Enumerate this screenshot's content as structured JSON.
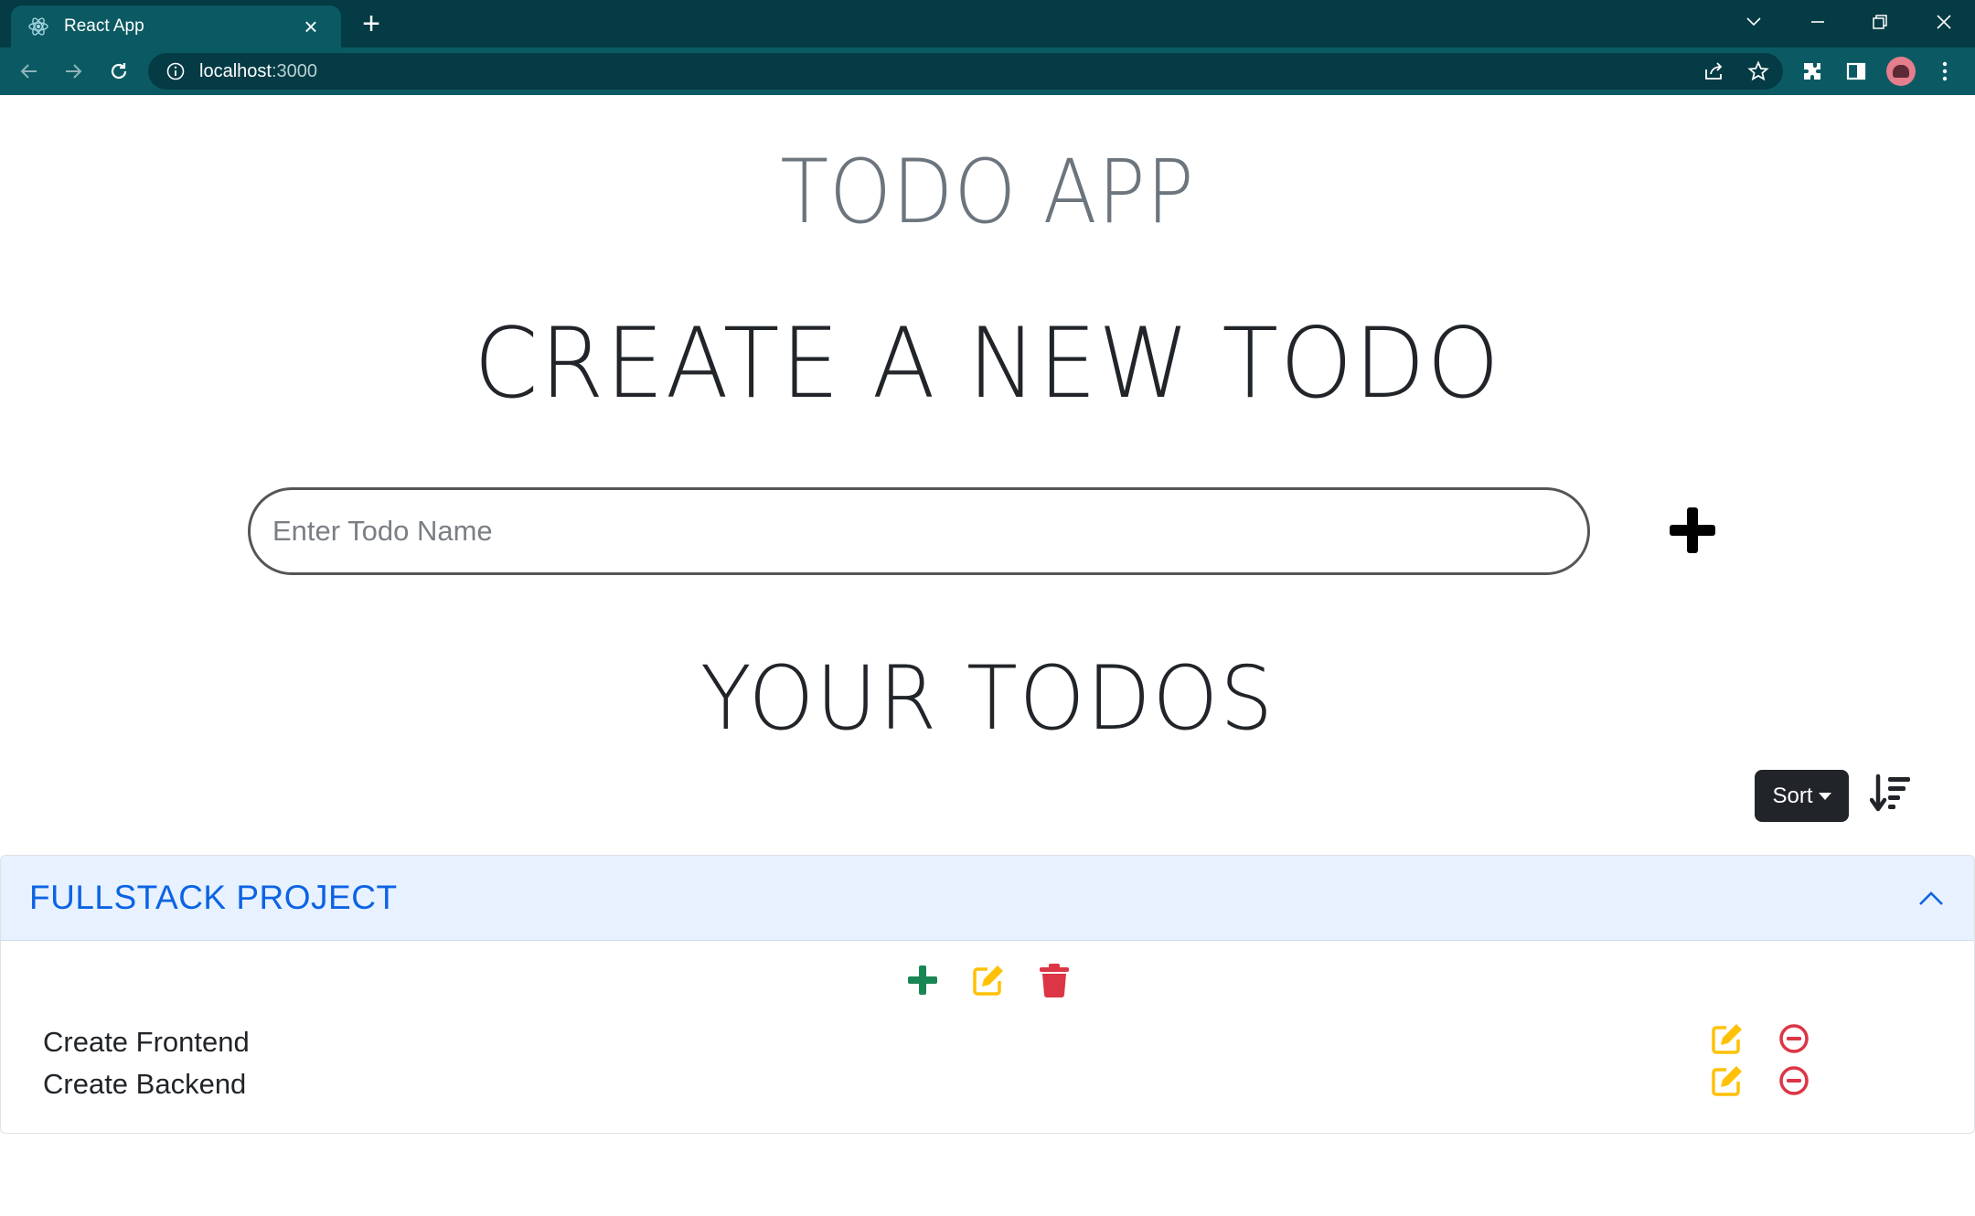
{
  "browser": {
    "tab_title": "React App",
    "url_host": "localhost",
    "url_port": ":3000"
  },
  "app": {
    "title": "TODO APP",
    "create_heading": "CREATE A NEW TODO",
    "input_placeholder": "Enter Todo Name",
    "input_value": "",
    "todos_heading": "YOUR TODOS",
    "sort_label": "Sort"
  },
  "groups": [
    {
      "title": "FULLSTACK PROJECT",
      "expanded": true,
      "todos": [
        {
          "text": "Create Frontend"
        },
        {
          "text": "Create Backend"
        }
      ]
    }
  ],
  "colors": {
    "chrome_dark": "#043b44",
    "chrome_light": "#0b5a63",
    "add_green": "#198754",
    "edit_yellow": "#ffc107",
    "delete_red": "#dc3545",
    "header_blue": "#0c63e4",
    "header_bg": "#e7f1ff"
  },
  "icons": {
    "tab_favicon": "react-icon",
    "add_todo": "plus-icon",
    "sort_order": "sort-descending-icon",
    "group_add": "plus-icon",
    "group_edit": "edit-icon",
    "group_delete": "trash-icon",
    "todo_edit": "edit-icon",
    "todo_remove": "minus-circle-icon"
  }
}
